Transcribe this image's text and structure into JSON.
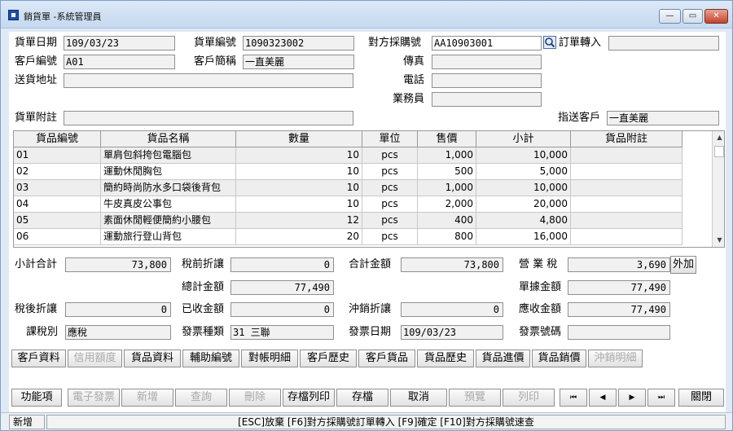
{
  "window": {
    "title": "銷貨單 -系統管理員",
    "minimize": "—",
    "restore": "▭",
    "close": "✕"
  },
  "header": {
    "doc_date_label": "貨單日期",
    "doc_date": "109/03/23",
    "doc_no_label": "貨單編號",
    "doc_no": "1090323002",
    "po_no_label": "對方採購號",
    "po_no": "AA10903001",
    "order_import_label": "訂單轉入",
    "order_import": "",
    "customer_no_label": "客戶編號",
    "customer_no": "A01",
    "customer_name_label": "客戶簡稱",
    "customer_name": "一直美麗",
    "fax_label": "傳真",
    "fax": "",
    "address_label": "送貨地址",
    "address": "",
    "phone_label": "電話",
    "phone": "",
    "salesperson_label": "業務員",
    "salesperson": "",
    "note_label": "貨單附註",
    "note": "",
    "ship_to_label": "指送客戶",
    "ship_to": "一直美麗"
  },
  "grid": {
    "columns": [
      "貨品編號",
      "貨品名稱",
      "數量",
      "單位",
      "售價",
      "小計",
      "貨品附註"
    ],
    "rows": [
      {
        "code": "01",
        "name": "單肩包斜挎包電腦包",
        "qty": "10",
        "unit": "pcs",
        "price": "1,000",
        "subtotal": "10,000",
        "note": ""
      },
      {
        "code": "02",
        "name": "運動休閒胸包",
        "qty": "10",
        "unit": "pcs",
        "price": "500",
        "subtotal": "5,000",
        "note": ""
      },
      {
        "code": "03",
        "name": "簡約時尚防水多口袋後背包",
        "qty": "10",
        "unit": "pcs",
        "price": "1,000",
        "subtotal": "10,000",
        "note": ""
      },
      {
        "code": "04",
        "name": "牛皮真皮公事包",
        "qty": "10",
        "unit": "pcs",
        "price": "2,000",
        "subtotal": "20,000",
        "note": ""
      },
      {
        "code": "05",
        "name": "素面休閒輕便簡約小腰包",
        "qty": "12",
        "unit": "pcs",
        "price": "400",
        "subtotal": "4,800",
        "note": ""
      },
      {
        "code": "06",
        "name": "運動旅行登山背包",
        "qty": "20",
        "unit": "pcs",
        "price": "800",
        "subtotal": "16,000",
        "note": ""
      }
    ]
  },
  "totals": {
    "subtotal_label": "小計合計",
    "subtotal": "73,800",
    "pre_tax_discount_label": "稅前折讓",
    "pre_tax_discount": "0",
    "total_amount_label": "合計金額",
    "total_amount": "73,800",
    "business_tax_label": "營 業 稅",
    "business_tax": "3,690",
    "tax_mode": "外加",
    "grand_total_label": "總計金額",
    "grand_total": "77,490",
    "doc_amount_label": "單據金額",
    "doc_amount": "77,490",
    "post_tax_discount_label": "稅後折讓",
    "post_tax_discount": "0",
    "received_label": "已收金額",
    "received": "0",
    "offset_discount_label": "沖銷折讓",
    "offset_discount": "0",
    "receivable_label": "應收金額",
    "receivable": "77,490",
    "tax_type_label": "課稅別",
    "tax_type": "應稅",
    "invoice_type_label": "發票種類",
    "invoice_type": "31 三聯",
    "invoice_date_label": "發票日期",
    "invoice_date": "109/03/23",
    "invoice_no_label": "發票號碼",
    "invoice_no": ""
  },
  "toolbar1": [
    "客戶資料",
    "信用額度",
    "貨品資料",
    "輔助編號",
    "對帳明細",
    "客戶歷史",
    "客戶貨品",
    "貨品歷史",
    "貨品進價",
    "貨品銷價",
    "沖銷明細"
  ],
  "toolbar2": [
    "功能項",
    "電子發票",
    "新增",
    "查詢",
    "刪除",
    "存檔列印",
    "存檔",
    "取消",
    "預覽",
    "列印"
  ],
  "nav": {
    "first": "⏮",
    "prev": "◀",
    "next": "▶",
    "last": "⏭",
    "close": "關閉"
  },
  "status": {
    "mode": "新增",
    "message": "[ESC]放棄 [F6]對方採購號訂單轉入 [F9]確定 [F10]對方採購號速查"
  }
}
